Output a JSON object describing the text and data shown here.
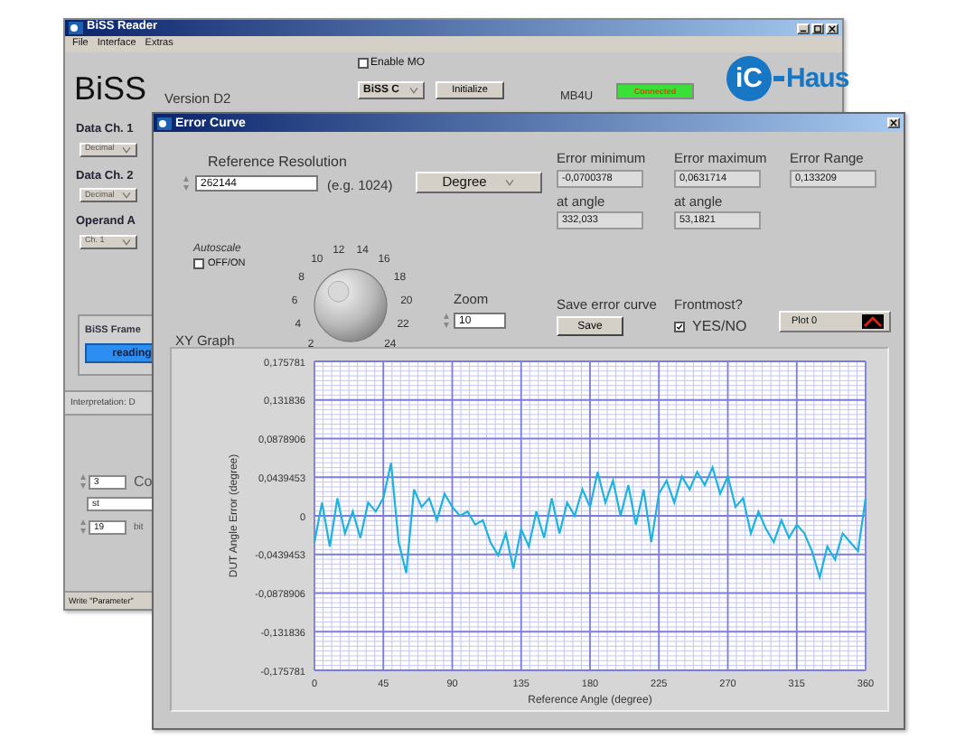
{
  "back_window": {
    "title": "BiSS Reader",
    "menu": [
      "File",
      "Interface",
      "Extras"
    ],
    "product": "BiSS",
    "version": "Version D2",
    "enable_mo": {
      "label": "Enable MO",
      "checked": false
    },
    "mode_select": {
      "value": "BiSS C"
    },
    "initialize_button": "Initialize",
    "device": "MB4U",
    "status": {
      "label": "Connected",
      "on": true
    },
    "logo": {
      "mark": "iC",
      "name": "Haus"
    },
    "channels": [
      {
        "label": "Data Ch. 1",
        "select": "Decimal"
      },
      {
        "label": "Data Ch. 2",
        "select": "Decimal"
      },
      {
        "label": "Operand A",
        "select": "Ch. 1"
      }
    ],
    "frame": {
      "label": "BiSS Frame",
      "indicator": "reading"
    },
    "tab": "Interpretation: D",
    "parameters": [
      {
        "kind": "numeric",
        "value": "3",
        "label": "Co"
      },
      {
        "kind": "text",
        "value": "st"
      },
      {
        "kind": "numeric",
        "value": "19",
        "label": "bit"
      }
    ],
    "status_bar": "Write \"Parameter\""
  },
  "error_curve_window": {
    "title": "Error Curve",
    "reference_resolution": {
      "label": "Reference Resolution",
      "value": "262144",
      "hint": "(e.g. 1024)"
    },
    "unit_select": {
      "value": "Degree"
    },
    "readouts": [
      {
        "label": "Error minimum",
        "value": "-0,0700378"
      },
      {
        "label": "Error maximum",
        "value": "0,0631714"
      },
      {
        "label": "Error Range",
        "value": "0,133209"
      },
      {
        "label": "at angle",
        "value": "332,033"
      },
      {
        "label": "at angle",
        "value": "53,1821"
      }
    ],
    "autoscale": {
      "label": "Autoscale",
      "option": "OFF/ON",
      "checked": false
    },
    "knob": {
      "scale": [
        "2",
        "4",
        "6",
        "8",
        "10",
        "12",
        "14",
        "16",
        "18",
        "20",
        "22",
        "24"
      ]
    },
    "zoom": {
      "label": "Zoom",
      "value": "10"
    },
    "save": {
      "label": "Save error curve",
      "button": "Save"
    },
    "frontmost": {
      "label": "Frontmost?",
      "option": "YES/NO",
      "checked": true
    },
    "graph": {
      "chart_data": {
        "type": "line",
        "title": "XY Graph",
        "xlabel": "Reference Angle (degree)",
        "ylabel": "DUT Angle Error (degree)",
        "x": [
          0,
          5,
          10,
          15,
          20,
          25,
          30,
          35,
          40,
          45,
          50,
          55,
          60,
          65,
          70,
          75,
          80,
          85,
          90,
          95,
          100,
          105,
          110,
          115,
          120,
          125,
          130,
          135,
          140,
          145,
          150,
          155,
          160,
          165,
          170,
          175,
          180,
          185,
          190,
          195,
          200,
          205,
          210,
          215,
          220,
          225,
          230,
          235,
          240,
          245,
          250,
          255,
          260,
          265,
          270,
          275,
          280,
          285,
          290,
          295,
          300,
          305,
          310,
          315,
          320,
          325,
          330,
          335,
          340,
          345,
          350,
          355,
          360
        ],
        "series": [
          {
            "name": "Plot 0",
            "color": "#1ab4e0",
            "values": [
              -0.03,
              0.015,
              -0.035,
              0.02,
              -0.02,
              0.005,
              -0.025,
              0.015,
              0.005,
              0.02,
              0.06,
              -0.03,
              -0.065,
              0.03,
              0.01,
              0.02,
              -0.005,
              0.025,
              0.01,
              0.0,
              0.005,
              -0.01,
              -0.005,
              -0.03,
              -0.045,
              -0.02,
              -0.06,
              -0.015,
              -0.035,
              0.005,
              -0.025,
              0.02,
              -0.02,
              0.015,
              0.0,
              0.03,
              0.01,
              0.05,
              0.015,
              0.04,
              0.0,
              0.035,
              -0.01,
              0.03,
              -0.03,
              0.025,
              0.04,
              0.015,
              0.045,
              0.03,
              0.05,
              0.035,
              0.055,
              0.025,
              0.045,
              0.01,
              0.02,
              -0.02,
              0.005,
              -0.015,
              -0.03,
              -0.005,
              -0.025,
              -0.01,
              -0.02,
              -0.04,
              -0.07,
              -0.035,
              -0.05,
              -0.02,
              -0.03,
              -0.04,
              0.02
            ]
          }
        ],
        "grid": true,
        "xlim": [
          0,
          360
        ],
        "ylim": [
          -0.175781,
          0.175781
        ],
        "xticks": [
          0,
          45,
          90,
          135,
          180,
          225,
          270,
          315,
          360
        ],
        "yticks": [
          {
            "value": 0.175781,
            "label": "0,175781"
          },
          {
            "value": 0.131836,
            "label": "0,131836"
          },
          {
            "value": 0.0878906,
            "label": "0,0878906"
          },
          {
            "value": 0.0439453,
            "label": "0,0439453"
          },
          {
            "value": 0,
            "label": "0"
          },
          {
            "value": -0.0439453,
            "label": "-0,0439453"
          },
          {
            "value": -0.0878906,
            "label": "-0,0878906"
          },
          {
            "value": -0.131836,
            "label": "-0,131836"
          },
          {
            "value": -0.175781,
            "label": "-0,175781"
          }
        ]
      }
    }
  }
}
